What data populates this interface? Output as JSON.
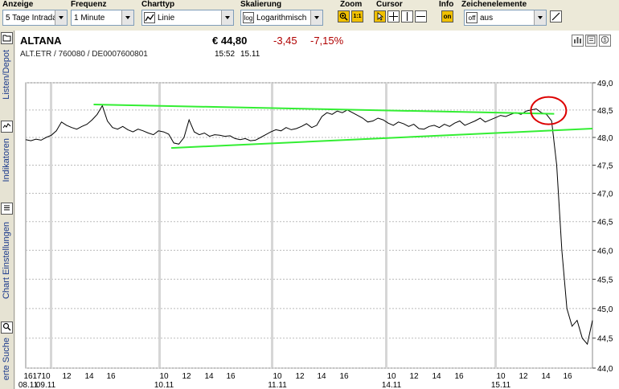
{
  "toolbar": {
    "anzeige": {
      "label": "Anzeige",
      "value": "5 Tage Intrada"
    },
    "frequenz": {
      "label": "Frequenz",
      "value": "1 Minute"
    },
    "charttyp": {
      "label": "Charttyp",
      "value": "Linie"
    },
    "skalierung": {
      "label": "Skalierung",
      "value": "Logarithmisch",
      "badge": "log"
    },
    "zoom": {
      "label": "Zoom",
      "reset": "1:1"
    },
    "cursor": {
      "label": "Cursor"
    },
    "info": {
      "label": "Info",
      "state": "on"
    },
    "zeichenelemente": {
      "label": "Zeichenelemente",
      "value": "aus",
      "badge": "off"
    }
  },
  "left_tabs": [
    "Listen/Depot",
    "Indikatoren",
    "Chart Einstellungen",
    "erte Suche"
  ],
  "header": {
    "name": "ALTANA",
    "ids": "ALT.ETR  /  760080  /  DE0007600801",
    "price": "€ 44,80",
    "change": "-3,45",
    "change_pct": "-7,15%",
    "time": "15:52",
    "date": "15.11"
  },
  "colors": {
    "price_line": "#000000",
    "trendlines": "#33ee33",
    "highlight_circle": "#dd0000",
    "negative": "#b00000"
  },
  "chart_data": {
    "type": "line",
    "y_scale": "log",
    "ylim": [
      44.0,
      49.0
    ],
    "y_ticks": [
      "49,0",
      "48,5",
      "48,0",
      "47,5",
      "47,0",
      "46,5",
      "46,0",
      "45,5",
      "45,0",
      "44,5",
      "44,0"
    ],
    "x_ticks": [
      {
        "label": "16",
        "sub": "08.11"
      },
      {
        "label": "17",
        "sub": ""
      },
      {
        "label": "10",
        "sub": "09.11"
      },
      {
        "label": "12",
        "sub": ""
      },
      {
        "label": "14",
        "sub": ""
      },
      {
        "label": "16",
        "sub": ""
      },
      {
        "label": "10",
        "sub": "10.11"
      },
      {
        "label": "12",
        "sub": ""
      },
      {
        "label": "14",
        "sub": ""
      },
      {
        "label": "16",
        "sub": ""
      },
      {
        "label": "10",
        "sub": "11.11"
      },
      {
        "label": "12",
        "sub": ""
      },
      {
        "label": "14",
        "sub": ""
      },
      {
        "label": "16",
        "sub": ""
      },
      {
        "label": "10",
        "sub": "14.11"
      },
      {
        "label": "12",
        "sub": ""
      },
      {
        "label": "14",
        "sub": ""
      },
      {
        "label": "16",
        "sub": ""
      },
      {
        "label": "10",
        "sub": "15.11"
      },
      {
        "label": "12",
        "sub": ""
      },
      {
        "label": "14",
        "sub": ""
      },
      {
        "label": "16",
        "sub": ""
      }
    ],
    "series": [
      {
        "values": [
          47.96,
          47.94,
          47.97,
          47.95,
          48.0,
          48.04,
          48.12,
          48.28,
          48.22,
          48.18,
          48.15,
          48.2,
          48.24,
          48.32,
          48.42,
          48.58,
          48.3,
          48.18,
          48.15,
          48.2,
          48.14,
          48.1,
          48.15,
          48.12,
          48.08,
          48.05,
          48.12,
          48.1,
          48.06,
          47.9,
          47.88,
          48.0,
          48.32,
          48.1,
          48.05,
          48.08,
          48.02,
          48.05,
          48.04,
          48.02,
          48.03,
          47.98,
          47.96,
          47.98,
          47.94,
          47.95,
          48.0,
          48.05,
          48.1,
          48.14,
          48.12,
          48.18,
          48.14,
          48.16,
          48.2,
          48.25,
          48.18,
          48.22,
          48.38,
          48.45,
          48.42,
          48.48,
          48.45,
          48.5,
          48.45,
          48.4,
          48.35,
          48.28,
          48.3,
          48.35,
          48.32,
          48.26,
          48.22,
          48.28,
          48.25,
          48.2,
          48.24,
          48.16,
          48.15,
          48.2,
          48.22,
          48.18,
          48.24,
          48.2,
          48.26,
          48.3,
          48.22,
          48.26,
          48.3,
          48.35,
          48.28,
          48.32,
          48.36,
          48.4,
          48.38,
          48.42,
          48.45,
          48.42,
          48.48,
          48.5,
          48.52,
          48.45,
          48.42,
          48.3,
          47.5,
          46.0,
          45.0,
          44.7,
          44.8,
          44.5,
          44.4,
          44.8
        ]
      }
    ],
    "trendlines": [
      {
        "from": [
          13.3,
          48.6
        ],
        "to": [
          103.5,
          48.43
        ]
      },
      {
        "from": [
          28.5,
          47.81
        ],
        "to": [
          111,
          48.16
        ]
      }
    ],
    "x_domain": [
      0,
      111
    ]
  }
}
